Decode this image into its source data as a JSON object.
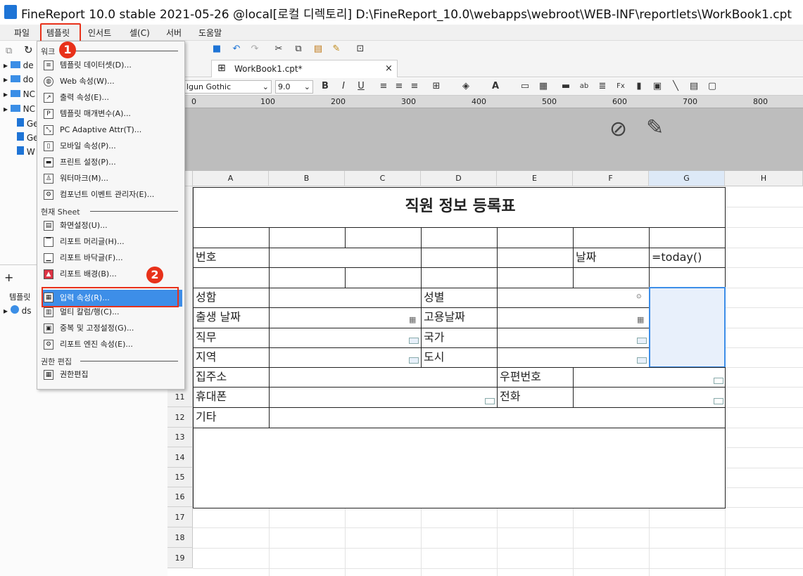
{
  "window": {
    "title": "FineReport 10.0 stable 2021-05-26 @local[로컬 디렉토리]    D:\\FineReport_10.0\\webapps\\webroot\\WEB-INF\\reportlets\\WorkBook1.cpt"
  },
  "menubar": {
    "items": [
      "파일",
      "템플릿",
      "인서트",
      "셀(C)",
      "서버",
      "도움말"
    ]
  },
  "left_panel": {
    "section_label": "워크",
    "tree": [
      "de",
      "do",
      "NC",
      "NC",
      "Ge",
      "Ge",
      "W"
    ],
    "bottom_tab": "템플릿",
    "bottom_item": "ds"
  },
  "dropdown": {
    "section1": "워크",
    "items1": [
      {
        "label": "템플릿 데이터셋(D)...",
        "icon": "database-icon"
      },
      {
        "label": "Web 속성(W)...",
        "icon": "globe-icon"
      },
      {
        "label": "출력 속성(E)...",
        "icon": "export-icon"
      },
      {
        "label": "템플릿 매개변수(A)...",
        "icon": "parameter-icon"
      },
      {
        "label": "PC Adaptive Attr(T)...",
        "icon": "resize-icon"
      },
      {
        "label": "모바일 속성(P)...",
        "icon": "mobile-icon"
      },
      {
        "label": "프린트 설정(P)...",
        "icon": "printer-icon"
      },
      {
        "label": "워터마크(M)...",
        "icon": "watermark-icon"
      },
      {
        "label": "컴포넌트 이벤트 관리자(E)...",
        "icon": "event-icon"
      }
    ],
    "section2": "현재 Sheet",
    "items2": [
      {
        "label": "화면설정(U)...",
        "icon": "screen-icon"
      },
      {
        "label": "리포트 머리글(H)...",
        "icon": "header-icon"
      },
      {
        "label": "리포트 바닥글(F)...",
        "icon": "footer-icon"
      },
      {
        "label": "리포트 배경(B)...",
        "icon": "background-icon"
      },
      {
        "label": "입력 속성(R)...",
        "icon": "input-attr-icon"
      },
      {
        "label": "멀티 칼럼/행(C)...",
        "icon": "multicolumn-icon"
      },
      {
        "label": "중복 및 고정설정(G)...",
        "icon": "freeze-icon"
      },
      {
        "label": "리포트 엔진 속성(E)...",
        "icon": "engine-icon"
      }
    ],
    "section3": "권한 편집",
    "items3": [
      {
        "label": "권한편집",
        "icon": "permission-icon"
      }
    ]
  },
  "badges": [
    "1",
    "2"
  ],
  "tab": {
    "label": "WorkBook1.cpt*"
  },
  "format": {
    "font": "lgun Gothic",
    "size": "9.0"
  },
  "ruler": [
    "0",
    "100",
    "200",
    "300",
    "400",
    "500",
    "600",
    "700",
    "800"
  ],
  "columns": [
    "A",
    "B",
    "C",
    "D",
    "E",
    "F",
    "G",
    "H"
  ],
  "rows": [
    "11",
    "12",
    "13",
    "14",
    "15",
    "16",
    "17",
    "18",
    "19"
  ],
  "report": {
    "title": "직원 정보 등록표",
    "number": "번호",
    "date": "날짜",
    "formula": "=today()",
    "name": "성함",
    "gender": "성별",
    "birth": "출생 날짜",
    "hire": "고용날짜",
    "job": "직무",
    "country": "국가",
    "region": "지역",
    "city": "도시",
    "address": "집주소",
    "zip": "우편번호",
    "mobile": "휴대폰",
    "phone": "전화",
    "etc": "기타"
  },
  "colors": {
    "highlight": "#3d8ee8",
    "badge": "#e8311a",
    "selection": "#e8f0fb"
  }
}
